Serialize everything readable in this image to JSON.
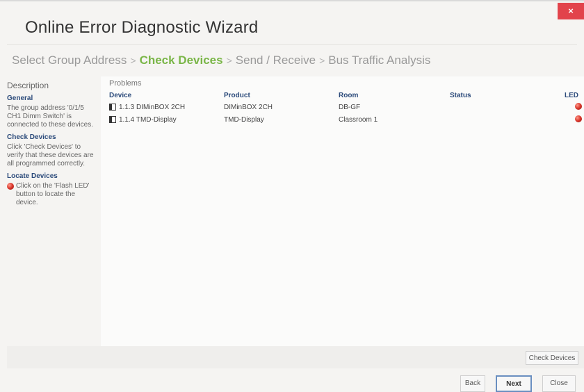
{
  "window": {
    "title": "Online Error Diagnostic Wizard",
    "close_glyph": "×"
  },
  "breadcrumb": [
    {
      "label": "Select Group Address",
      "active": false
    },
    {
      "label": "Check Devices",
      "active": true
    },
    {
      "label": "Send / Receive",
      "active": false
    },
    {
      "label": "Bus Traffic Analysis",
      "active": false
    }
  ],
  "breadcrumb_separator": ">",
  "sidebar": {
    "heading": "Description",
    "general_title": "General",
    "general_text": "The group address '0/1/5 CH1 Dimm Switch' is connected to these devices.",
    "check_title": "Check Devices",
    "check_text": "Click 'Check Devices' to verify that these devices are all programmed correctly.",
    "locate_title": "Locate Devices",
    "locate_text": "Click on the 'Flash LED' button to locate the device."
  },
  "problems": {
    "label": "Problems",
    "columns": [
      "Device",
      "Product",
      "Room",
      "Status",
      "LED"
    ],
    "rows": [
      {
        "device": "1.1.3 DIMinBOX 2CH",
        "product": "DIMinBOX 2CH",
        "room": "DB-GF",
        "status": ""
      },
      {
        "device": "1.1.4 TMD-Display",
        "product": "TMD-Display",
        "room": "Classroom 1",
        "status": ""
      }
    ]
  },
  "buttons": {
    "check_devices": "Check Devices",
    "back": "Back",
    "next": "Next",
    "close": "Close"
  },
  "colors": {
    "active_step": "#7ab648",
    "section_title": "#2b4a7a",
    "close_button": "#e2434b",
    "led": "#d9342a"
  },
  "icons": {
    "device": "device-icon",
    "led": "red-led-icon"
  }
}
